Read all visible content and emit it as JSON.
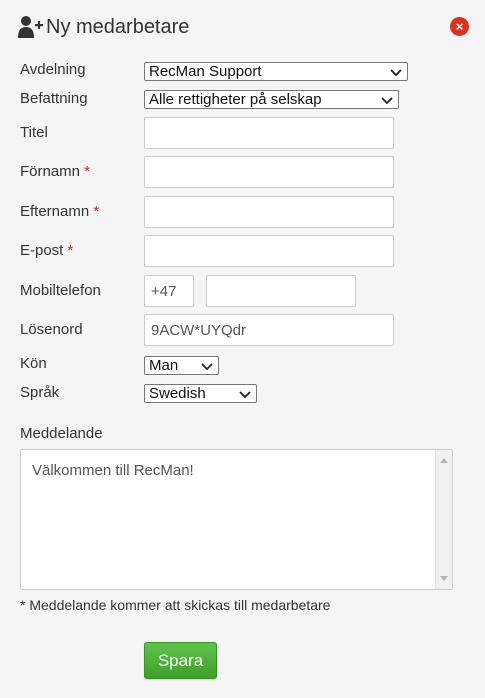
{
  "dialog": {
    "title": "Ny medarbetare",
    "close_label": "×"
  },
  "form": {
    "department": {
      "label": "Avdelning",
      "value": "RecMan Support"
    },
    "position": {
      "label": "Befattning",
      "value": "Alle rettigheter på selskap"
    },
    "title": {
      "label": "Titel",
      "value": ""
    },
    "first_name": {
      "label": "Förnamn",
      "required_mark": "*",
      "value": ""
    },
    "last_name": {
      "label": "Efternamn",
      "required_mark": "*",
      "value": ""
    },
    "email": {
      "label": "E-post",
      "required_mark": "*",
      "value": ""
    },
    "mobile": {
      "label": "Mobiltelefon",
      "country_code": "+47",
      "value": ""
    },
    "password": {
      "label": "Lösenord",
      "value": "9ACW*UYQdr"
    },
    "gender": {
      "label": "Kön",
      "value": "Man"
    },
    "language": {
      "label": "Språk",
      "value": "Swedish"
    },
    "message": {
      "label": "Meddelande",
      "value": "Välkommen till RecMan!"
    },
    "message_note": "* Meddelande kommer att skickas till medarbetare",
    "save_label": "Spara"
  },
  "colors": {
    "close_button": "#d9341f",
    "required": "#c62828",
    "save_button": "#4caf35"
  }
}
